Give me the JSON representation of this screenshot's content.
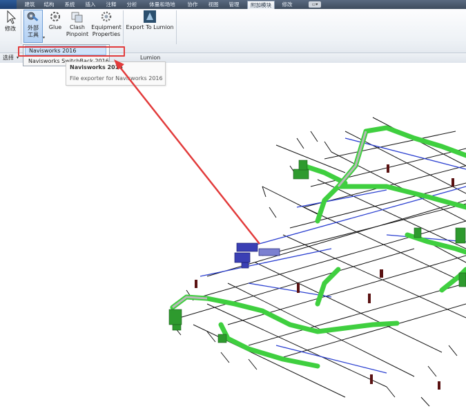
{
  "tabs": [
    {
      "label": "建筑"
    },
    {
      "label": "结构"
    },
    {
      "label": "系统"
    },
    {
      "label": "插入"
    },
    {
      "label": "注释"
    },
    {
      "label": "分析"
    },
    {
      "label": "体量和场地"
    },
    {
      "label": "协作"
    },
    {
      "label": "视图"
    },
    {
      "label": "管理"
    },
    {
      "label": "附加模块"
    },
    {
      "label": "修改"
    }
  ],
  "ribbon": {
    "modify_label": "修改",
    "external_tools_line1": "外部",
    "external_tools_line2": "工具",
    "glue_label": "Glue",
    "clash_line1": "Clash",
    "clash_line2": "Pinpoint",
    "equipment_line1": "Equipment",
    "equipment_line2": "Properties",
    "export_lumion_label": "Export To Lumion",
    "panel_select": "选择",
    "panel_lumion": "Lumion"
  },
  "dropdown": {
    "item1": "Navisworks 2016",
    "item2": "Navisworks SwitchBack 2016"
  },
  "tooltip": {
    "title": "Navisworks 2016",
    "description": "File exporter for Navisworks 2016"
  },
  "colors": {
    "highlight": "#e23b3b",
    "arrow": "#e23b3b",
    "duct_green": "#3fcf3f",
    "pipe_blue": "#2a3fd0",
    "line_black": "#111111"
  }
}
